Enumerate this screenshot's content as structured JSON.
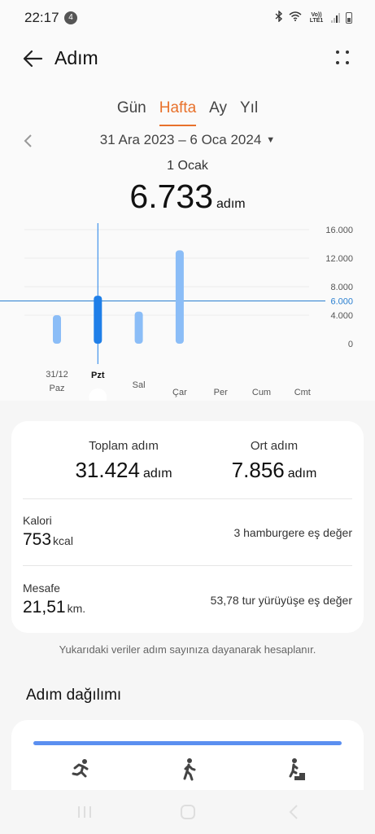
{
  "status": {
    "time": "22:17",
    "notification_count": "4",
    "network": "Vo)) LTE1"
  },
  "header": {
    "title": "Adım"
  },
  "tabs": [
    {
      "label": "Gün"
    },
    {
      "label": "Hafta"
    },
    {
      "label": "Ay"
    },
    {
      "label": "Yıl"
    }
  ],
  "period": {
    "range": "31 Ara 2023 – 6 Oca 2024",
    "selected_day": "1 Ocak",
    "steps": "6.733",
    "steps_unit": "adım"
  },
  "chart_data": {
    "type": "bar",
    "categories": [
      "Paz",
      "Pzt",
      "Sal",
      "Çar",
      "Per",
      "Cum",
      "Cmt"
    ],
    "category_dates": [
      "31/12",
      "",
      "",
      "",
      "",
      "",
      ""
    ],
    "values": [
      4000,
      6733,
      4500,
      13100,
      0,
      0,
      0
    ],
    "selected_index": 1,
    "average_line": 6000,
    "y_ticks": [
      "0",
      "4.000",
      "6.000",
      "8.000",
      "12.000",
      "16.000"
    ],
    "ylim": [
      0,
      16000
    ],
    "bar_color": "#8bbdf7",
    "selected_color": "#1f7fe8",
    "average_color": "#2a7fd0"
  },
  "summary": {
    "total_label": "Toplam adım",
    "total_value": "31.424",
    "total_unit": "adım",
    "avg_label": "Ort adım",
    "avg_value": "7.856",
    "avg_unit": "adım",
    "calorie_label": "Kalori",
    "calorie_value": "753",
    "calorie_unit": "kcal",
    "calorie_equiv": "3 hamburgere eş değer",
    "distance_label": "Mesafe",
    "distance_value": "21,51",
    "distance_unit": "km.",
    "distance_equiv": "53,78 tur yürüyüşe eş değer"
  },
  "note": "Yukarıdaki veriler adım sayınıza dayanarak hesaplanır.",
  "distribution": {
    "title": "Adım dağılımı",
    "icons": [
      "running-icon",
      "walking-icon",
      "climbing-icon"
    ]
  },
  "colors": {
    "accent": "#e8712b",
    "bar": "#5b8ff0"
  }
}
